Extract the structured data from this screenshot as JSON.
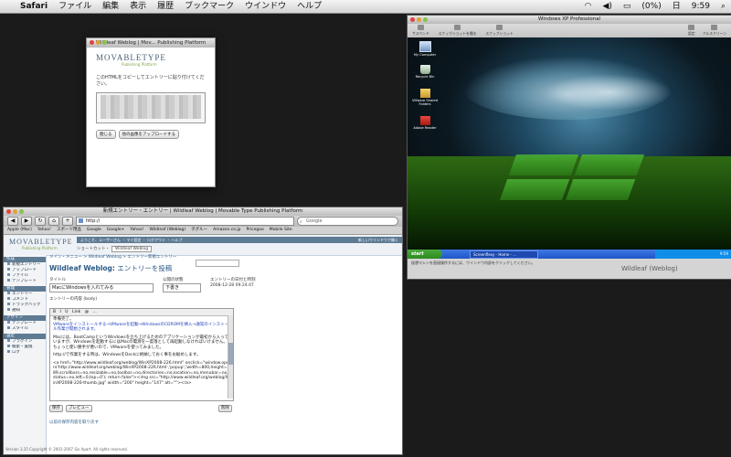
{
  "menubar": {
    "app": "Safari",
    "menus": [
      "ファイル",
      "編集",
      "表示",
      "履歴",
      "ブックマーク",
      "ウインドウ",
      "ヘルプ"
    ],
    "battery": "(0%)",
    "date": "日",
    "time": "9:59"
  },
  "popup": {
    "title": "Wildleaf Weblog | Mov... Publishing Platform",
    "logo": "MOVABLETYPE",
    "logo_sub": "Publishing Platform",
    "description": "このHTMLをコピーしてエントリーに貼り付けてください。",
    "buttons": [
      "閉じる",
      "他の画像をアップロードする"
    ]
  },
  "safari": {
    "title": "新規エントリー・エントリー | Wildleaf Weblog | Movable Type Publishing Platform",
    "url": "http://",
    "search_placeholder": "Google",
    "bookmarks": [
      "Apple (Mac)",
      "Yahoo!",
      "スポーツ用品",
      "Google",
      "Google+",
      "Yahoo!",
      "Wildleaf (Weblog)",
      "タグルー",
      "Amazon.co.jp",
      "Pricegoo",
      "Mobile Site"
    ],
    "logo": "MOVABLETYPE",
    "logo_sub": "Publishing Platform",
    "nav": "ようこそ、ユーザーさん ・ マイ設定 ・ ログアウト ・ ヘルプ",
    "nav_right": "新しいウインドウで開く",
    "blog_label": "ショートカット・",
    "blog_select": "Wildleaf Weblog"
  },
  "sidebar": {
    "sections": [
      {
        "header": "作成",
        "items": [
          "新規エントリー",
          "アップロード",
          "ファイル",
          "テンプレート"
        ]
      },
      {
        "header": "管理",
        "items": [
          "エントリー",
          "コメント",
          "トラックバック",
          "通知"
        ]
      },
      {
        "header": "デザイン",
        "items": [
          "テンプレート",
          "スタイル"
        ]
      },
      {
        "header": "設定",
        "items": [
          "プラグイン",
          "検索・置換",
          "ログ"
        ]
      }
    ]
  },
  "main": {
    "breadcrumb": "メイン・メニュー > Wildleaf Weblog > エントリー新規エントリー",
    "blog_name": "Wildleaf Weblog:",
    "page_title": "エントリーを投稿",
    "title_label": "タイトル",
    "title_value": "MacにWindowsを入れてみる",
    "status_label": "公開の状態",
    "status_value": "下書き",
    "date_label": "エントリーの日付と時刻",
    "date_value": "2008-12-28 09:24:47",
    "body_label": "エントリーの内容 (body)",
    "toolbar": "B I U Link @ ...",
    "body_lines": [
      "準備完了。",
      "VMwareをインストールする→VMwareを起動→WindowsのCDROMを挿入→通常のインストール作業が開始されます。",
      "Macには、BootCampというWindowsを立ち上げるためのアプリケーションが最初から入っていますが、Windowsを起動するにはMacの電源を一度落として再起動しなければいけません。ちょっと使い勝手が悪いので、VMwareを使ってみました。",
      "http://で作業をする時は、WindowsをDockに格納しておく事をお勧めします。",
      "<a href=\"http://www.wildleaf.org/weblog/WinXP2008-226.html\" onclick=\"window.open('http://www.wildleaf.org/weblog/WinXP2008-226.html','popup','width=800,height=589,scrollbars=no,resizable=no,toolbar=no,directories=no,location=no,menubar=no,status=no,left=0,top=0'); return false\"><img src=\"http://www.wildleaf.org/weblog/WinXP2008-226-thumb.jpg\" width=\"200\" height=\"147\" alt=\"\"></a>"
    ],
    "actions": [
      "保存",
      "プレビュー",
      "削除"
    ],
    "footer_link": "以前の保存内容を取り戻す",
    "version": "Version 3.35 Copyright © 2001-2007 Six Apart. All rights reserved."
  },
  "vmware": {
    "title": "Windows XP Professional",
    "tools": [
      "サスペンド",
      "スナップショットを撮る",
      "スナップショット"
    ],
    "tools_right": [
      "設定",
      "フルスクリーン"
    ],
    "desktop_icons": [
      "My Computer",
      "Recycle Bin",
      "VMware Shared Folders",
      "Adobe Reader"
    ],
    "start": "start",
    "task_app": "Screenflexy - Home - ...",
    "clock": "9:59",
    "status": "仮想マシンを直接操作するには、ウインドウ内部をクリックしてください。"
  },
  "watermark": "Wildleaf (Weblog)"
}
